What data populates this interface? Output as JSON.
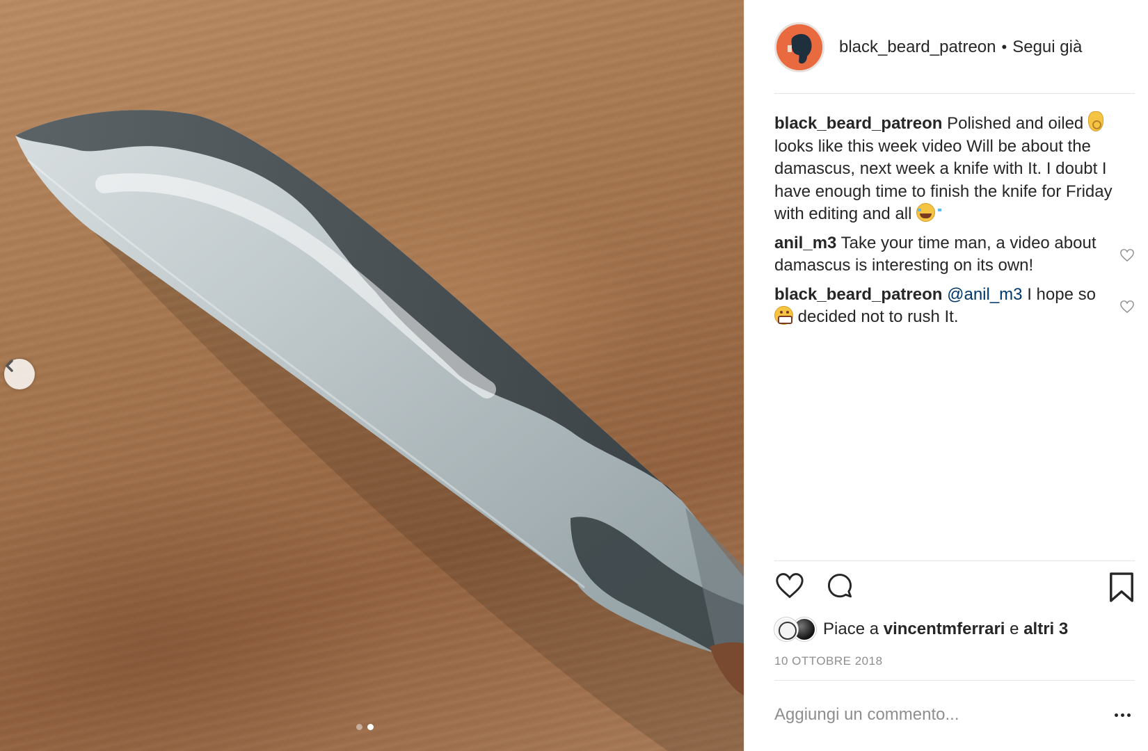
{
  "post": {
    "username": "black_beard_patreon",
    "separator": "•",
    "follow_status": "Segui già"
  },
  "caption": {
    "user": "black_beard_patreon",
    "text_1": "Polished and oiled",
    "text_2": "looks like this week video Will be about the damascus, next week a knife with It. I doubt I have enough time to finish the knife for Friday with editing and all"
  },
  "comments": [
    {
      "user": "anil_m3",
      "text": "Take your time man, a video about damascus is interesting on its own!"
    },
    {
      "user": "black_beard_patreon",
      "mention": "@anil_m3",
      "text_1": "I hope so",
      "text_2": "decided not to rush It."
    }
  ],
  "likes": {
    "prefix": "Piace a",
    "user": "vincentmferrari",
    "connector": "e",
    "others": "altri 3"
  },
  "date": "10 OTTOBRE 2018",
  "add_comment": {
    "placeholder": "Aggiungi un commento..."
  },
  "carousel": {
    "total": 2,
    "active_index": 1
  },
  "icons": {
    "prev": "chevron-left-icon",
    "like": "heart-icon",
    "comment": "comment-bubble-icon",
    "save": "bookmark-icon",
    "more": "more-options-icon"
  },
  "colors": {
    "avatar_bg": "#ea6a3f",
    "mention": "#00376b",
    "muted": "#8e8e8e",
    "text": "#262626"
  }
}
